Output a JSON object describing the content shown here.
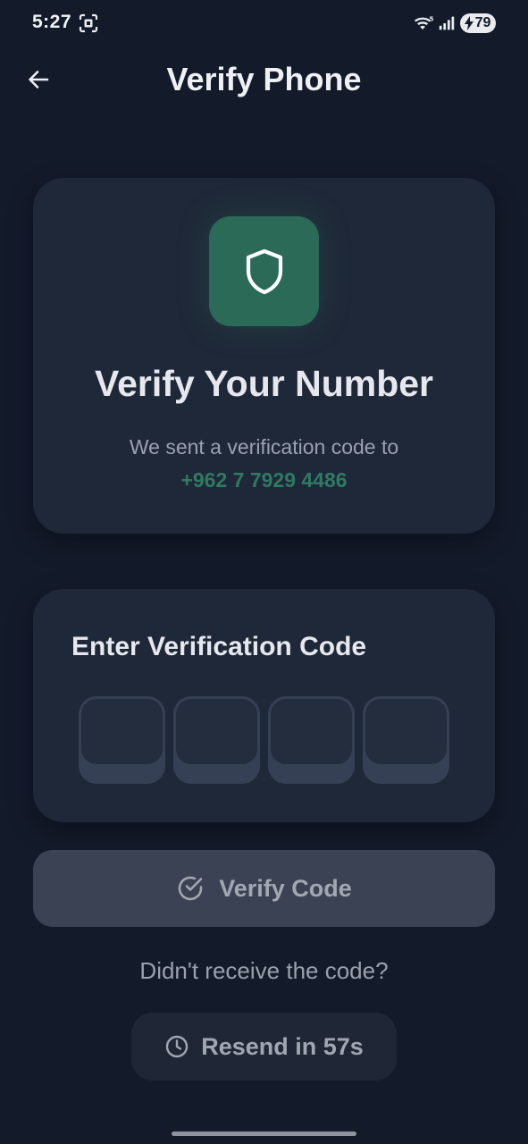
{
  "status_bar": {
    "time": "5:27",
    "battery_level": "79",
    "icons": [
      "screenshot-icon",
      "wifi-icon",
      "signal-icon",
      "battery-charging-icon"
    ]
  },
  "header": {
    "title": "Verify Phone",
    "back_icon": "arrow-left-icon"
  },
  "hero": {
    "icon": "shield-icon",
    "title": "Verify Your Number",
    "subtitle": "We sent a verification code to",
    "phone": "+962 7 7929 4486"
  },
  "code_entry": {
    "title": "Enter Verification Code",
    "digits": [
      "",
      "",
      "",
      ""
    ]
  },
  "verify_button": {
    "label": "Verify Code",
    "icon": "check-circle-icon"
  },
  "resend": {
    "prompt": "Didn't receive the code?",
    "label": "Resend in 57s",
    "icon": "clock-icon"
  },
  "colors": {
    "background": "#131a2a",
    "card": "#1f2838",
    "accent_green": "#2a6a57",
    "phone_text": "#2e7a62",
    "disabled_button": "#3b4253"
  }
}
